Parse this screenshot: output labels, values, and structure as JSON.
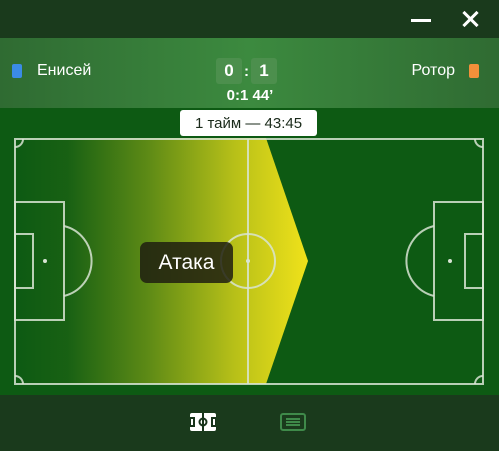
{
  "window": {
    "minimize_icon": "minimize-icon",
    "close_icon": "close-icon"
  },
  "match": {
    "home": {
      "name": "Енисей",
      "color": "#3b8be6"
    },
    "away": {
      "name": "Ротор",
      "color": "#f2903a"
    },
    "score": {
      "home": "0",
      "separator": ":",
      "away": "1"
    },
    "last_event": "0:1 44’"
  },
  "field": {
    "period_label": "1 тайм — 43:45",
    "event_label": "Атака",
    "attack_color": "#f0e21a"
  },
  "tabs": [
    {
      "name": "field-view",
      "icon": "field-icon",
      "active": true
    },
    {
      "name": "text-view",
      "icon": "list-icon",
      "active": false
    }
  ]
}
